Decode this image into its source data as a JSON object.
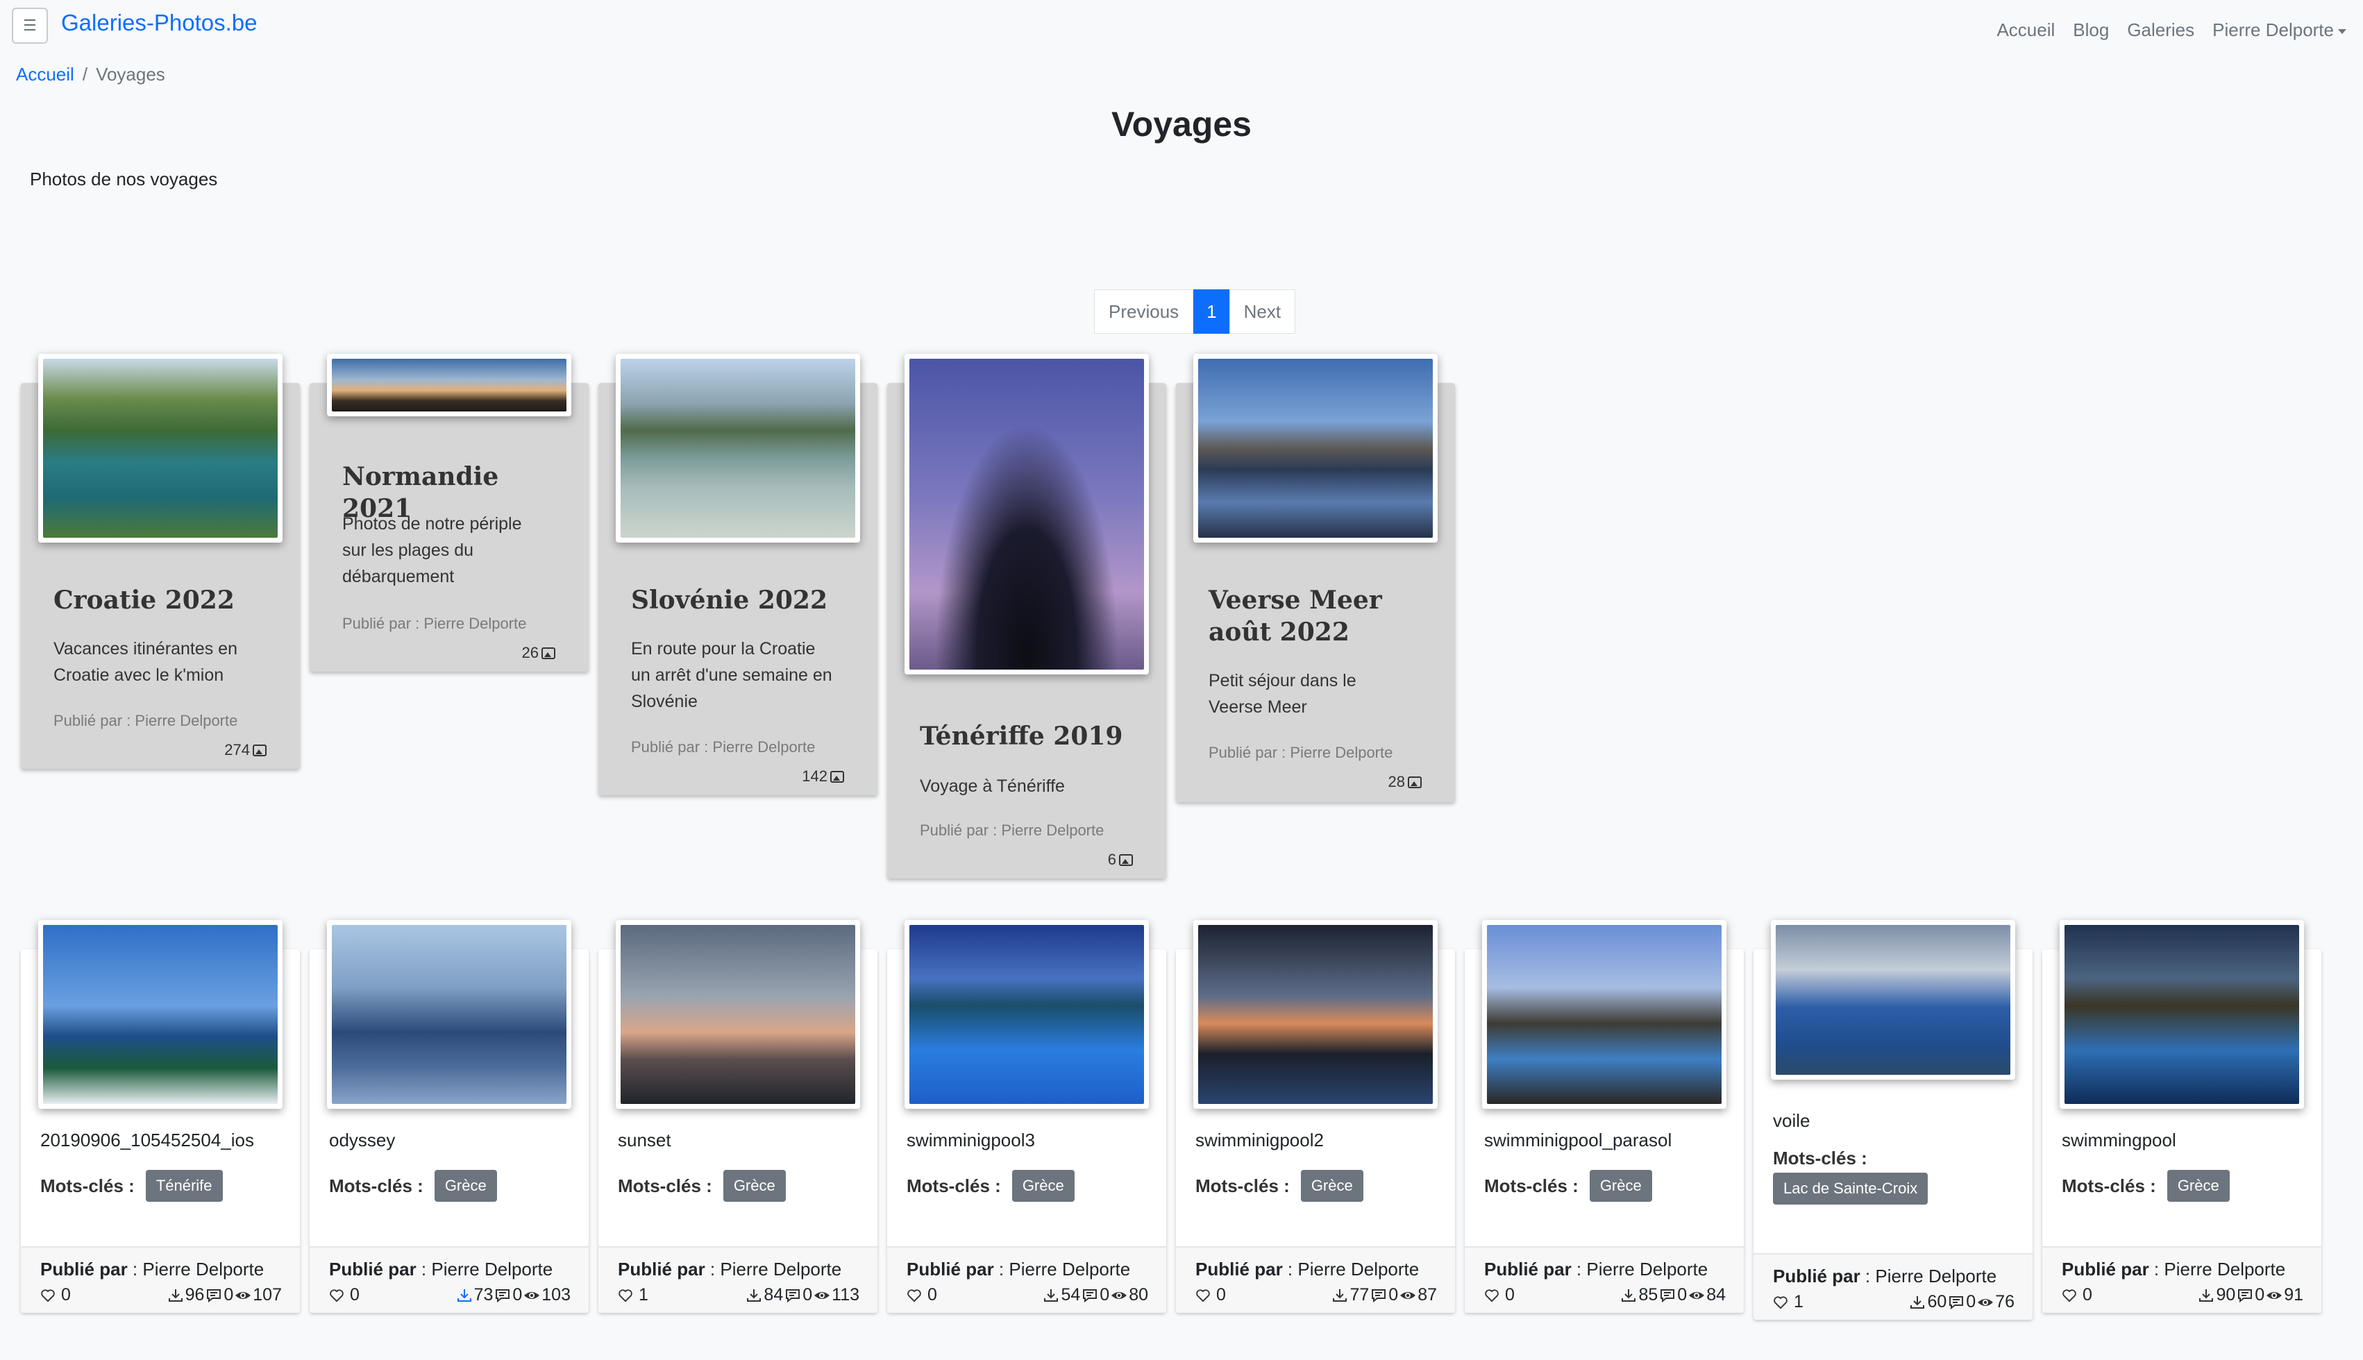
{
  "navbar": {
    "toggler_icon": "hamburger-icon",
    "brand": "Galeries-Photos.be",
    "links": [
      "Accueil",
      "Blog",
      "Galeries",
      "Pierre Delporte"
    ]
  },
  "breadcrumb": {
    "home": "Accueil",
    "separator": "/",
    "current": "Voyages"
  },
  "page": {
    "title": "Voyages",
    "description": "Photos de nos voyages"
  },
  "pagination": {
    "previous": "Previous",
    "current": "1",
    "next": "Next"
  },
  "galleries": [
    {
      "title": "Croatie 2022",
      "description": "Vacances itinérantes en Croatie avec le k'mion",
      "published": "Publié par : Pierre Delporte",
      "count": "274"
    },
    {
      "title": "Normandie 2021",
      "description": "Photos de notre périple sur les plages du débarquement",
      "published": "Publié par : Pierre Delporte",
      "count": "26"
    },
    {
      "title": "Slovénie 2022",
      "description": "En route pour la Croatie un arrêt d'une semaine en Slovénie",
      "published": "Publié par : Pierre Delporte",
      "count": "142"
    },
    {
      "title": "Ténériffe 2019",
      "description": "Voyage à Ténériffe",
      "published": "Publié par : Pierre Delporte",
      "count": "6"
    },
    {
      "title": "Veerse Meer août 2022",
      "description": "Petit séjour dans le Veerse Meer",
      "published": "Publié par : Pierre Delporte",
      "count": "28"
    }
  ],
  "photos": [
    {
      "name": "20190906_105452504_ios",
      "kw_label": "Mots-clés :",
      "keyword": "Ténérife",
      "pub_label": "Publié par",
      "author": " : Pierre Delporte",
      "likes": "0",
      "downloads": "96",
      "comments": "0",
      "views": "107"
    },
    {
      "name": "odyssey",
      "kw_label": "Mots-clés :",
      "keyword": "Grèce",
      "pub_label": "Publié par",
      "author": " : Pierre Delporte",
      "likes": "0",
      "downloads": "73",
      "comments": "0",
      "views": "103"
    },
    {
      "name": "sunset",
      "kw_label": "Mots-clés :",
      "keyword": "Grèce",
      "pub_label": "Publié par",
      "author": " : Pierre Delporte",
      "likes": "1",
      "downloads": "84",
      "comments": "0",
      "views": "113"
    },
    {
      "name": "swimminigpool3",
      "kw_label": "Mots-clés :",
      "keyword": "Grèce",
      "pub_label": "Publié par",
      "author": " : Pierre Delporte",
      "likes": "0",
      "downloads": "54",
      "comments": "0",
      "views": "80"
    },
    {
      "name": "swimminigpool2",
      "kw_label": "Mots-clés :",
      "keyword": "Grèce",
      "pub_label": "Publié par",
      "author": " : Pierre Delporte",
      "likes": "0",
      "downloads": "77",
      "comments": "0",
      "views": "87"
    },
    {
      "name": "swimminigpool_parasol",
      "kw_label": "Mots-clés :",
      "keyword": "Grèce",
      "pub_label": "Publié par",
      "author": " : Pierre Delporte",
      "likes": "0",
      "downloads": "85",
      "comments": "0",
      "views": "84"
    },
    {
      "name": "voile",
      "kw_label": "Mots-clés :",
      "keyword": "Lac de Sainte-Croix",
      "pub_label": "Publié par",
      "author": " : Pierre Delporte",
      "likes": "1",
      "downloads": "60",
      "comments": "0",
      "views": "76"
    },
    {
      "name": "swimmingpool",
      "kw_label": "Mots-clés :",
      "keyword": "Grèce",
      "pub_label": "Publié par",
      "author": " : Pierre Delporte",
      "likes": "0",
      "downloads": "90",
      "comments": "0",
      "views": "91"
    }
  ],
  "colors": {
    "accent": "#0d6efd",
    "gallery_card": "#d6d6d6",
    "badge": "#6c757d"
  }
}
